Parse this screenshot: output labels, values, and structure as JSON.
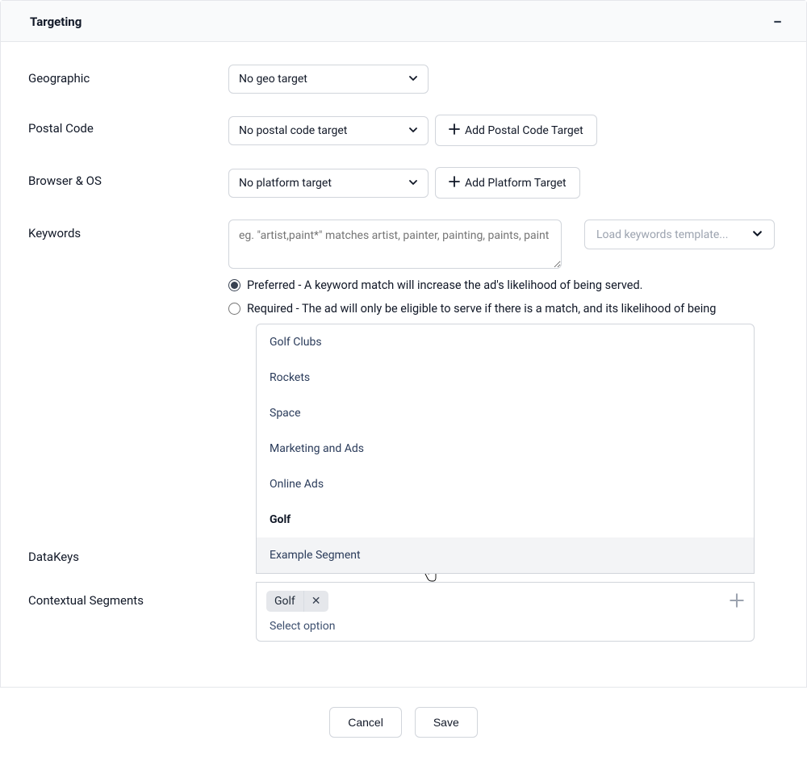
{
  "panel": {
    "title": "Targeting"
  },
  "fields": {
    "geographic": {
      "label": "Geographic",
      "value": "No geo target"
    },
    "postal": {
      "label": "Postal Code",
      "value": "No postal code target",
      "add_btn": "Add Postal Code Target"
    },
    "browser": {
      "label": "Browser & OS",
      "value": "No platform target",
      "add_btn": "Add Platform Target"
    },
    "keywords": {
      "label": "Keywords",
      "placeholder": "eg. \"artist,paint*\" matches artist, painter, painting, paints, paint",
      "template_btn": "Load keywords template...",
      "preferred": "Preferred - A keyword match will increase the ad's likelihood of being served.",
      "required": "Required - The ad will only be eligible to serve if there is a match, and its likelihood of being"
    },
    "datakeys": {
      "label": "DataKeys"
    },
    "contextual": {
      "label": "Contextual Segments"
    }
  },
  "dropdown": {
    "items": [
      {
        "label": "Golf Clubs"
      },
      {
        "label": "Rockets"
      },
      {
        "label": "Space"
      },
      {
        "label": "Marketing and Ads"
      },
      {
        "label": "Online Ads"
      },
      {
        "label": "Golf",
        "selected": true
      },
      {
        "label": "Example Segment",
        "hover": true
      }
    ]
  },
  "tagbox": {
    "tag": "Golf",
    "placeholder": "Select option"
  },
  "buttons": {
    "cancel": "Cancel",
    "save": "Save"
  }
}
